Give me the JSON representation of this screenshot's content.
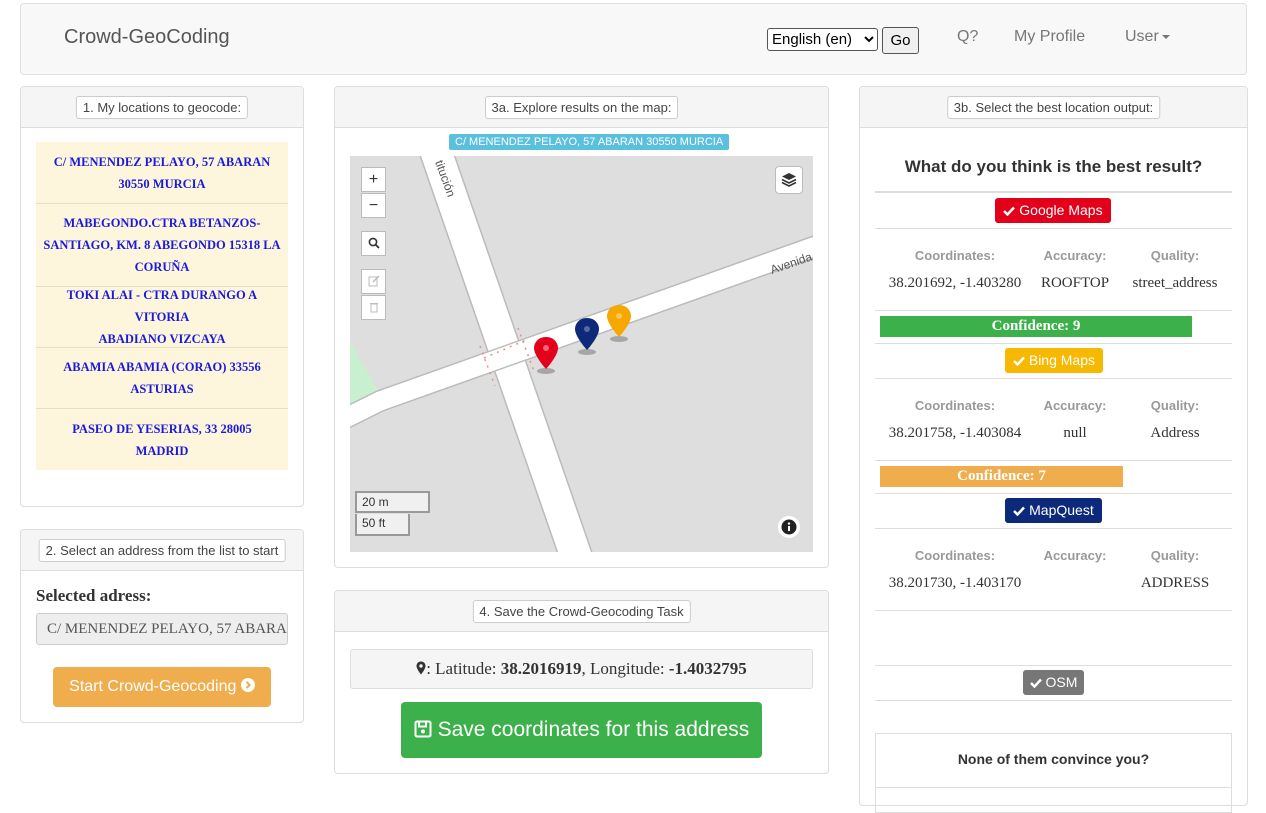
{
  "navbar": {
    "brand": "Crowd-GeoCoding",
    "language_value": "English (en)",
    "go_label": "Go",
    "links": [
      "Q?",
      "My Profile",
      "User"
    ]
  },
  "panel1": {
    "title": "1. My locations to geocode:",
    "locations": [
      [
        "C/ MENENDEZ PELAYO, 57 ABARAN",
        "30550 MURCIA"
      ],
      [
        "MABEGONDO.CTRA BETANZOS-",
        "SANTIAGO, KM. 8 ABEGONDO 15318 LA",
        "CORUÑA"
      ],
      [
        "TOKI ALAI - CTRA DURANGO A VITORIA",
        "ABADIANO VIZCAYA"
      ],
      [
        "ABAMIA ABAMIA (CORAO) 33556",
        "ASTURIAS"
      ],
      [
        "PASEO DE YESERIAS, 33 28005",
        "MADRID"
      ]
    ]
  },
  "panel2": {
    "title": "2. Select an address from the list to start",
    "selected_label": "Selected adress:",
    "selected_value": "C/ MENENDEZ PELAYO, 57 ABARAN 30550 MURCIA",
    "start_label": "Start Crowd-Geocoding"
  },
  "panel3a": {
    "title": "3a. Explore results on the map:",
    "address_tag": "C/ MENENDEZ PELAYO, 57 ABARAN 30550 MURCIA",
    "map": {
      "zoom_in": "+",
      "zoom_out": "−",
      "street_1": "titución",
      "street_2": "Avenida",
      "scale_metric": "20 m",
      "scale_imperial": "50 ft",
      "marker_colors": [
        "#e3001b",
        "#0d2a7a",
        "#f6a800"
      ]
    }
  },
  "panel4": {
    "title": "4. Save the Crowd-Geocoding Task",
    "lat_label": ": Latitude: ",
    "lat_value": "38.2016919",
    "lon_label": ", Longitude: ",
    "lon_value": "-1.4032795",
    "save_label": "Save coordinates for this address"
  },
  "panel3b": {
    "title": "3b. Select the best location output:",
    "question": "What do you think is the best result?",
    "col_labels": [
      "Coordinates:",
      "Accuracy:",
      "Quality:"
    ],
    "providers": [
      {
        "name": "Google Maps",
        "color": "#e3001b",
        "coords": "38.201692, -1.403280",
        "accuracy": "ROOFTOP",
        "quality": "street_address",
        "confidence": "Confidence: 9",
        "confidence_color": "#3cb04a",
        "confidence_level": 0.9
      },
      {
        "name": "Bing Maps",
        "color": "#f6b800",
        "coords": "38.201758, -1.403084",
        "accuracy": "null",
        "quality": "Address",
        "confidence": "Confidence: 7",
        "confidence_color": "#f0ad4e",
        "confidence_level": 0.7
      },
      {
        "name": "MapQuest",
        "color": "#0d2a7a",
        "coords": "38.201730, -1.403170",
        "accuracy": "",
        "quality": "ADDRESS"
      },
      {
        "name": "OSM",
        "color": "#777777"
      }
    ],
    "none_text": "None of them convince you?"
  }
}
